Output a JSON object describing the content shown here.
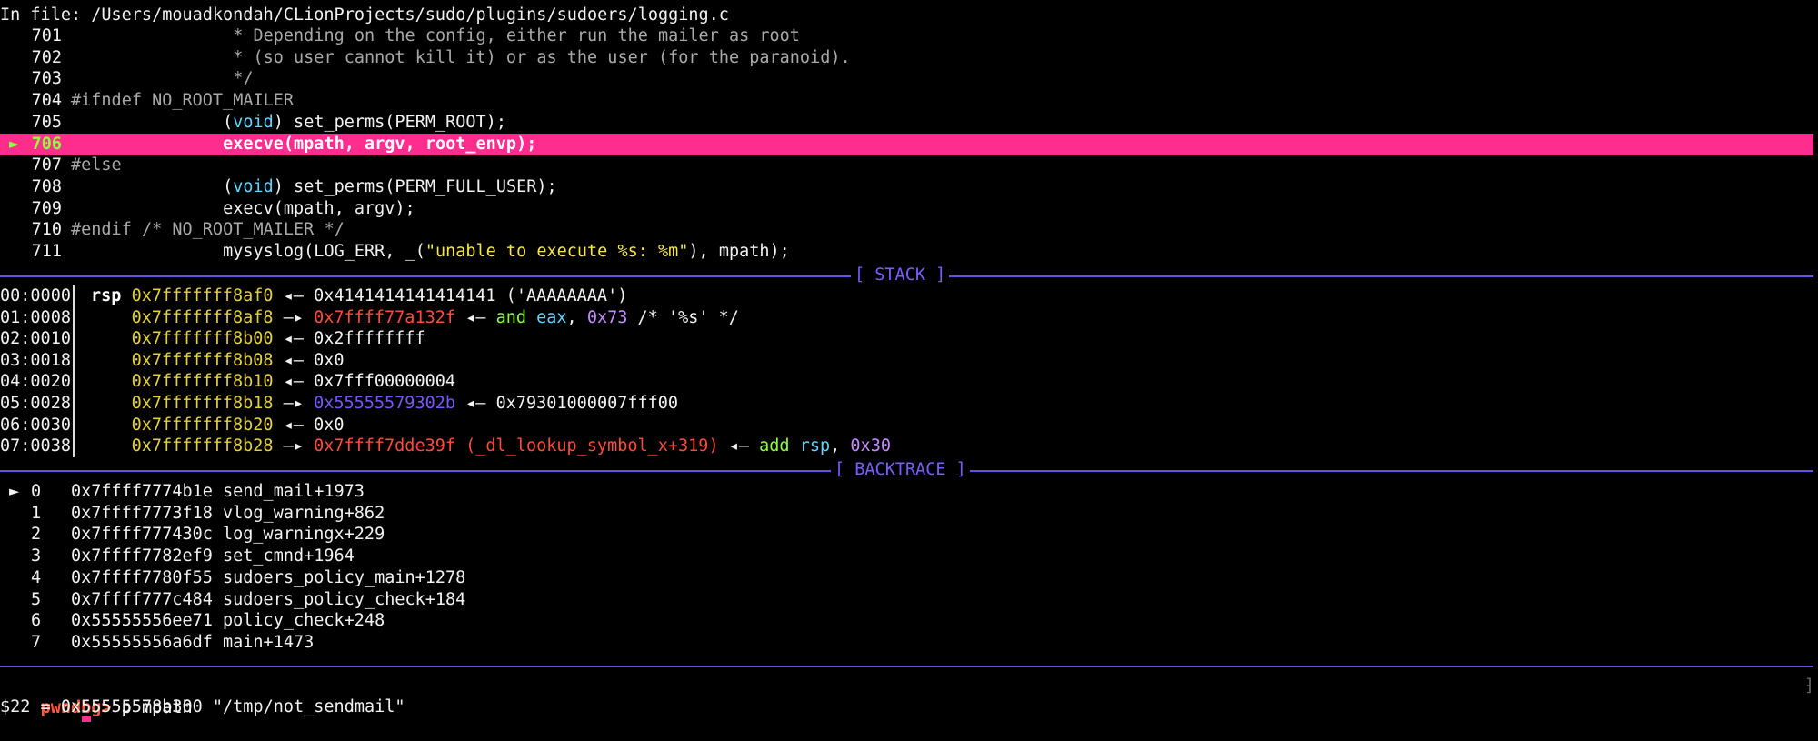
{
  "file_header": "In file: /Users/mouadkondah/CLionProjects/sudo/plugins/sudoers/logging.c",
  "source": {
    "current_marker": "►",
    "lines": [
      {
        "num": "701",
        "text": "                * Depending on the config, either run the mailer as root",
        "kind": "comment"
      },
      {
        "num": "702",
        "text": "                * (so user cannot kill it) or as the user (for the paranoid).",
        "kind": "comment"
      },
      {
        "num": "703",
        "text": "                */",
        "kind": "comment"
      },
      {
        "num": "704",
        "text": "#ifndef NO_ROOT_MAILER",
        "kind": "comment"
      },
      {
        "num": "705",
        "pre": "               (",
        "kw": "void",
        "post": ") set_perms(PERM_ROOT);",
        "kind": "cast"
      },
      {
        "num": "706",
        "text": "               execve(mpath, argv, root_envp);",
        "kind": "current"
      },
      {
        "num": "707",
        "text": "#else",
        "kind": "comment"
      },
      {
        "num": "708",
        "pre": "               (",
        "kw": "void",
        "post": ") set_perms(PERM_FULL_USER);",
        "kind": "cast"
      },
      {
        "num": "709",
        "text": "               execv(mpath, argv);",
        "kind": "plain"
      },
      {
        "num": "710",
        "text": "#endif /* NO_ROOT_MAILER */",
        "kind": "comment"
      },
      {
        "num": "711",
        "pre": "               mysyslog(LOG_ERR, _(",
        "str": "\"unable to execute %s: %m\"",
        "post": "), mpath);",
        "kind": "string"
      }
    ]
  },
  "stack": {
    "label": "[ STACK ]",
    "rows": [
      {
        "off": "00:0000",
        "reg": "rsp",
        "addr": "0x7fffffff8af0",
        "arrow": "◂—",
        "val": "0x4141414141414141 ('AAAAAAAA')"
      },
      {
        "off": "01:0008",
        "addr": "0x7fffffff8af8",
        "arrow": "—▸",
        "lib": "0x7ffff77a132f",
        "arrow2": "◂—",
        "insn": "and",
        "reg2": "eax",
        "imm": "0x73",
        "tail": "/* '%s' */"
      },
      {
        "off": "02:0010",
        "addr": "0x7fffffff8b00",
        "arrow": "◂—",
        "val": "0x2ffffffff"
      },
      {
        "off": "03:0018",
        "addr": "0x7fffffff8b08",
        "arrow": "◂—",
        "val": "0x0"
      },
      {
        "off": "04:0020",
        "addr": "0x7fffffff8b10",
        "arrow": "◂—",
        "val": "0x7fff00000004"
      },
      {
        "off": "05:0028",
        "addr": "0x7fffffff8b18",
        "arrow": "—▸",
        "heap": "0x55555579302b",
        "arrow2": "◂—",
        "val": "0x79301000007fff00"
      },
      {
        "off": "06:0030",
        "addr": "0x7fffffff8b20",
        "arrow": "◂—",
        "val": "0x0"
      },
      {
        "off": "07:0038",
        "addr": "0x7fffffff8b28",
        "arrow": "—▸",
        "lib": "0x7ffff7dde39f (_dl_lookup_symbol_x+319)",
        "arrow2": "◂—",
        "insn": "add",
        "reg2": "rsp",
        "imm": "0x30"
      }
    ]
  },
  "backtrace": {
    "label": "[ BACKTRACE ]",
    "marker": "►",
    "frames": [
      {
        "idx": "0",
        "addr": "0x7ffff7774b1e",
        "fn": "send_mail+1973"
      },
      {
        "idx": "1",
        "addr": "0x7ffff7773f18",
        "fn": "vlog_warning+862"
      },
      {
        "idx": "2",
        "addr": "0x7ffff777430c",
        "fn": "log_warningx+229"
      },
      {
        "idx": "3",
        "addr": "0x7ffff7782ef9",
        "fn": "set_cmnd+1964"
      },
      {
        "idx": "4",
        "addr": "0x7ffff7780f55",
        "fn": "sudoers_policy_main+1278"
      },
      {
        "idx": "5",
        "addr": "0x7ffff777c484",
        "fn": "sudoers_policy_check+184"
      },
      {
        "idx": "6",
        "addr": "0x55555556ee71",
        "fn": "policy_check+248"
      },
      {
        "idx": "7",
        "addr": "0x55555556a6df",
        "fn": "main+1473"
      }
    ]
  },
  "console": {
    "prompt": "pwndbg>",
    "command": " p mpath",
    "output": "$22 = 0x55555578b300 \"/tmp/not_sendmail\""
  },
  "colors": {
    "highlight_bar": "#ff2d8e",
    "separator": "#6d4fe8",
    "prompt": "#ff5a3c",
    "stack_addr": "#e4d23a",
    "lib_addr": "#ff4b3a",
    "heap_addr": "#7b55ff"
  }
}
